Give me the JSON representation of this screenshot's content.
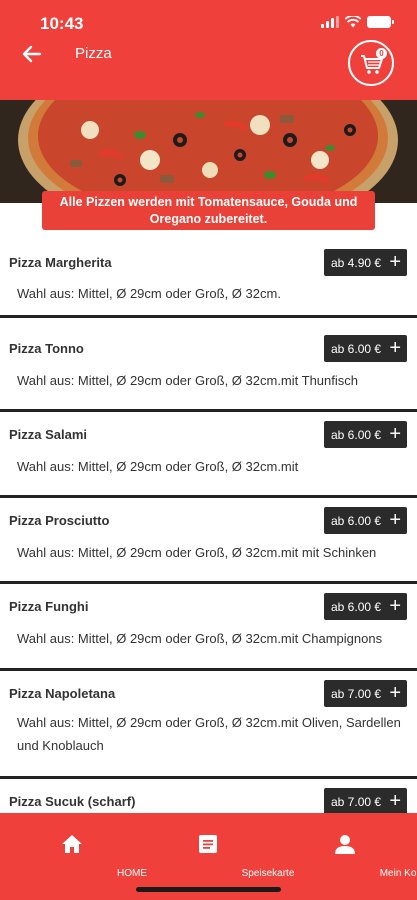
{
  "status_bar": {
    "time": "10:43"
  },
  "header": {
    "title": "Pizza",
    "cart_count": "0"
  },
  "banner": {
    "info_text_line1": "Alle Pizzen werden mit Tomatensauce, Gouda und",
    "info_text_line2": "Oregano zubereitet."
  },
  "menu_items": [
    {
      "name": "Pizza Margherita",
      "price": "ab 4.90 €",
      "desc_line1": "Wahl aus: Mittel, Ø 29cm oder Groß, Ø 32cm.",
      "desc_line2": ""
    },
    {
      "name": "Pizza Tonno",
      "price": "ab 6.00 €",
      "desc_line1": "Wahl aus: Mittel, Ø 29cm oder Groß, Ø 32cm.mit Thunfisch",
      "desc_line2": ""
    },
    {
      "name": "Pizza Salami",
      "price": "ab 6.00 €",
      "desc_line1": "Wahl aus: Mittel, Ø 29cm oder Groß, Ø 32cm.mit",
      "desc_line2": ""
    },
    {
      "name": "Pizza Prosciutto",
      "price": "ab 6.00 €",
      "desc_line1": "Wahl aus: Mittel, Ø 29cm oder Groß, Ø 32cm.mit mit Schinken",
      "desc_line2": ""
    },
    {
      "name": "Pizza Funghi",
      "price": "ab 6.00 €",
      "desc_line1": "Wahl aus: Mittel, Ø 29cm oder Groß, Ø 32cm.mit Champignons",
      "desc_line2": ""
    },
    {
      "name": "Pizza Napoletana",
      "price": "ab 7.00 €",
      "desc_line1": "Wahl aus: Mittel, Ø 29cm oder Groß, Ø 32cm.mit Oliven, Sardellen",
      "desc_line2": "und Knoblauch"
    },
    {
      "name": "Pizza Sucuk (scharf)",
      "price": "ab 7.00 €",
      "desc_line1": "",
      "desc_line2": ""
    }
  ],
  "bottom_nav": {
    "home_label": "HOME",
    "menu_label": "Speisekarte",
    "account_label": "Mein Konto"
  },
  "colors": {
    "primary": "#f0403c",
    "price_button": "#2b2b2b"
  }
}
